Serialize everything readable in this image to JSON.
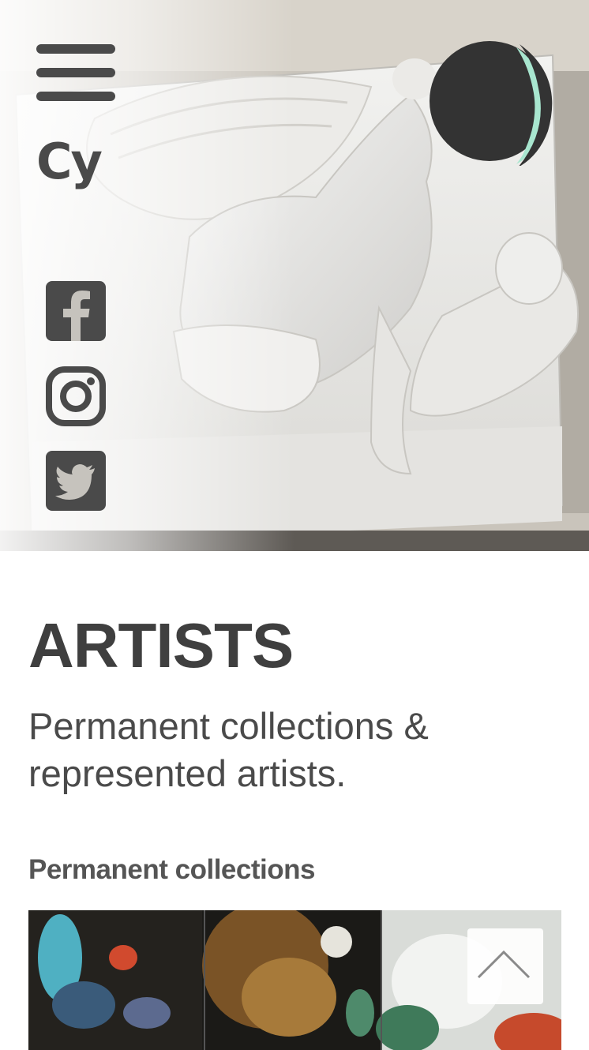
{
  "header": {
    "brand_short": "Cy",
    "menu_icon": "hamburger-menu-icon",
    "logo_icon": "moon-logo-icon",
    "social_icons": [
      "facebook-icon",
      "instagram-icon",
      "twitter-icon"
    ]
  },
  "main": {
    "title": "ARTISTS",
    "subtitle": "Permanent collections & represented artists.",
    "section_heading": "Permanent collections"
  },
  "scroll_top_icon": "chevron-up-icon",
  "colors": {
    "icon_gray": "#4a4a4a",
    "logo_dark": "#333333",
    "logo_accent": "#a8e6cf",
    "title": "#3f3f3f"
  }
}
